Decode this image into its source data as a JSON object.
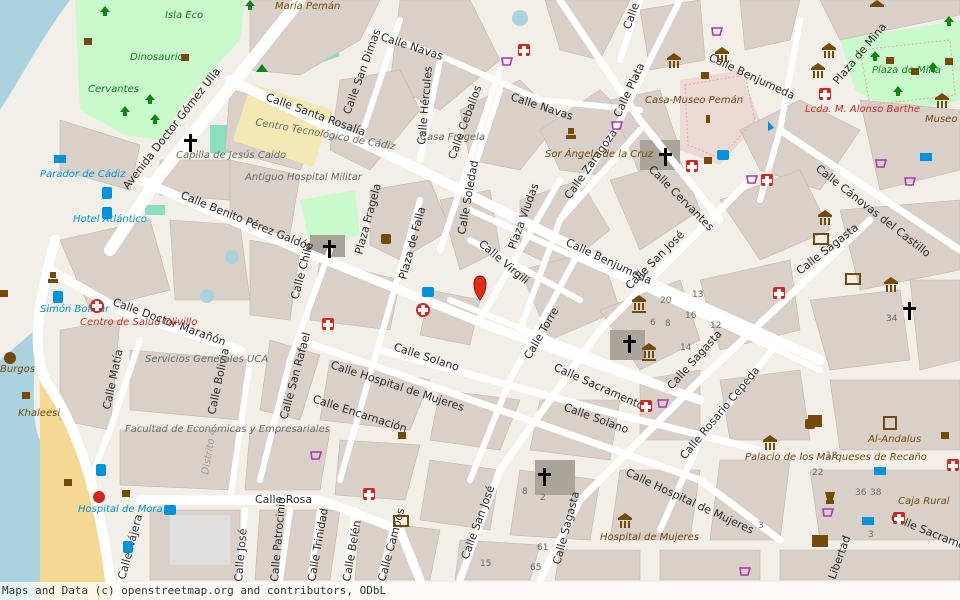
{
  "attribution": "Maps and Data (c) openstreetmap.org and contributors, ODbL",
  "colors": {
    "water": "#aad3df",
    "land": "#f2efe9",
    "building": "#d9d0c9",
    "park": "#c8facc",
    "pitch": "#88e0be",
    "road": "#ffffff",
    "beach": "#f5d993",
    "poi_brown": "#734a08",
    "health_red": "#d4261d",
    "shop_purple": "#ac39ac",
    "transport_blue": "#0092da",
    "marker_red": "#e32b1a"
  },
  "streets": [
    "Calle Navas",
    "Calle Santa Rosalía",
    "Calle San Dimas",
    "Calle Hércules",
    "Calle Ceballos",
    "Calle Navas",
    "Calle Plata",
    "Calle Zaragoza",
    "Calle Cervantes",
    "Calle San José",
    "Calle Benjumeda",
    "Calle Virgili",
    "Plaza Viudas",
    "Calle Soledad",
    "Calle Benito Pérez Galdós",
    "Avenida Doctor Gómez Ulla",
    "Calle Doctor Marañón",
    "Plaza Fragela",
    "Plaza de Falla",
    "Calle Chile",
    "Calle Solano",
    "Calle Hospital de Mujeres",
    "Calle Torre",
    "Calle Sacramento",
    "Calle Sagasta",
    "Calle Solano",
    "Calle Encarnación",
    "Calle San Rafael",
    "Calle Bolivia",
    "Calle Matía",
    "Calle Rosario Cepeda",
    "Calle Hospital de Mujeres",
    "Calle Rosa",
    "Calle San José",
    "Calle Sagasta",
    "Calle Cánovas del Castillo",
    "Calle Sagasta",
    "Calle Vea",
    "Plaza de Mina",
    "Calle Benjumeda",
    "Calle Trinidad",
    "Calle Belén",
    "Calle Campos",
    "Calle Patrocinio",
    "Calle José",
    "Calle Nájera",
    "Calle Sacramento",
    "Libertad"
  ],
  "pois": [
    "Isla Eco",
    "María Pemán",
    "Dinosaurio",
    "Cervantes",
    "Casa Fragela",
    "Centro Tecnológico de Cádiz",
    "Capilla de Jesús Caído",
    "Antiguo Hospital Militar",
    "Parador de Cádiz",
    "Hotel Atlántico",
    "Simón Bolívar",
    "Centro de Salud Olivillo",
    "Servicios Generales UCA",
    "Facultad de Económicas y Empresariales",
    "Distrito 4",
    "Sor Ángela de la Cruz",
    "Casa-Museo Pemán",
    "Plaza de Mina",
    "Lcda. M. Alonso Barthe",
    "Museo de C",
    "Hospital de Mora",
    "Burgos",
    "Khaleesi",
    "Palacio de los Marqueses de Recaño",
    "Hospital de Mujeres",
    "Al-Andalus",
    "Caja Rural"
  ],
  "house_numbers": [
    "20",
    "13",
    "6",
    "8",
    "16",
    "12",
    "14",
    "8",
    "2",
    "61",
    "65",
    "15",
    "34",
    "18",
    "22",
    "36",
    "38",
    "3",
    "3"
  ],
  "search_marker": "red-pin"
}
